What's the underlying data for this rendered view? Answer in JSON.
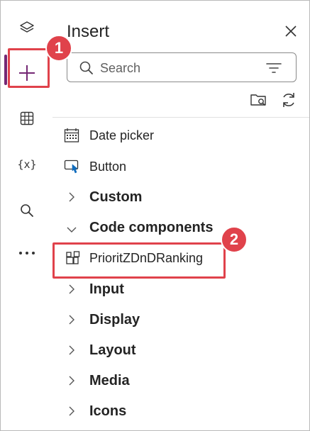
{
  "rail": {
    "items": [
      {
        "name": "layers-icon"
      },
      {
        "name": "plus-icon"
      },
      {
        "name": "table-icon"
      },
      {
        "name": "variables-icon"
      },
      {
        "name": "search-icon"
      },
      {
        "name": "more-icon"
      }
    ]
  },
  "panel": {
    "title": "Insert",
    "search_placeholder": "Search"
  },
  "items": [
    {
      "label": "Date picker",
      "icon": "calendar-icon"
    },
    {
      "label": "Button",
      "icon": "button-cursor-icon"
    }
  ],
  "categories_top": [
    {
      "label": "Custom",
      "expanded": false
    },
    {
      "label": "Code components",
      "expanded": true
    }
  ],
  "code_component": {
    "label": "PrioritZDnDRanking",
    "icon": "component-icon"
  },
  "categories_bottom": [
    {
      "label": "Input"
    },
    {
      "label": "Display"
    },
    {
      "label": "Layout"
    },
    {
      "label": "Media"
    },
    {
      "label": "Icons"
    }
  ],
  "annotations": {
    "step1": "1",
    "step2": "2"
  },
  "colors": {
    "accent": "#742774",
    "callout": "#e0424b"
  }
}
